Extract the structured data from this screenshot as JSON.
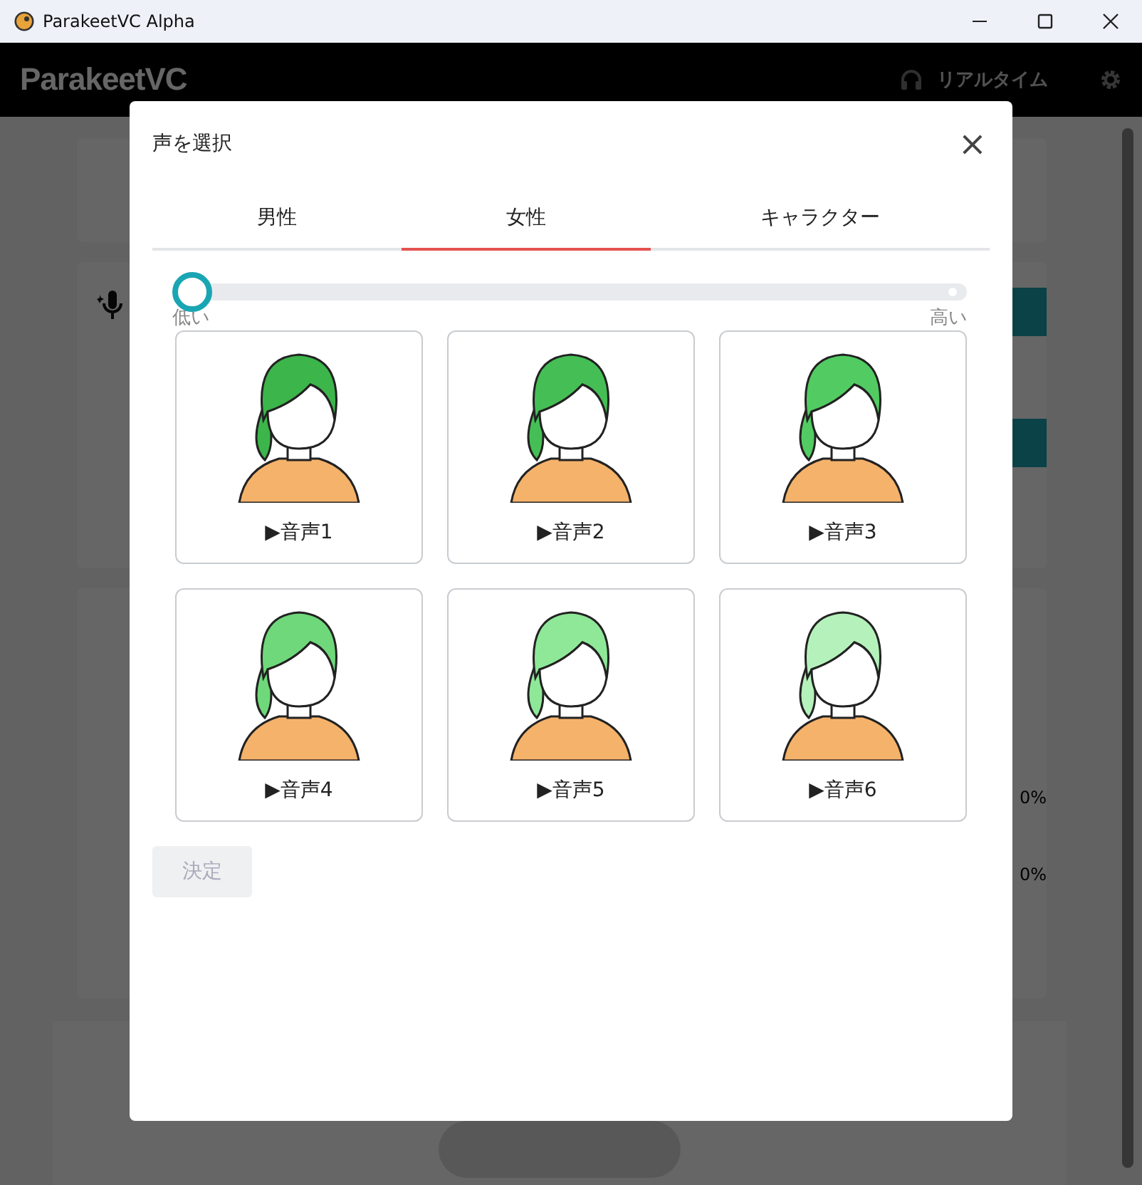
{
  "window": {
    "title": "ParakeetVC Alpha"
  },
  "app_header": {
    "logo": "ParakeetVC",
    "mode": "リアルタイム"
  },
  "background": {
    "readings": [
      "0%",
      "0%"
    ]
  },
  "dialog": {
    "title": "声を選択",
    "close": "×",
    "tabs": [
      {
        "label": "男性",
        "selected": false
      },
      {
        "label": "女性",
        "selected": true
      },
      {
        "label": "キャラクター",
        "selected": false
      }
    ],
    "pitch_slider": {
      "level": 0,
      "min_label": "低い",
      "max_label": "高い"
    },
    "voices": [
      {
        "label": "▶音声1",
        "color": "#3cb54a"
      },
      {
        "label": "▶音声2",
        "color": "#45bf55"
      },
      {
        "label": "▶音声3",
        "color": "#52cc62"
      },
      {
        "label": "▶音声4",
        "color": "#6fd87a"
      },
      {
        "label": "▶音声5",
        "color": "#8ee898"
      },
      {
        "label": "▶音声6",
        "color": "#b5f2bb"
      }
    ],
    "confirm_button": {
      "label": "決定",
      "disabled": true
    }
  }
}
